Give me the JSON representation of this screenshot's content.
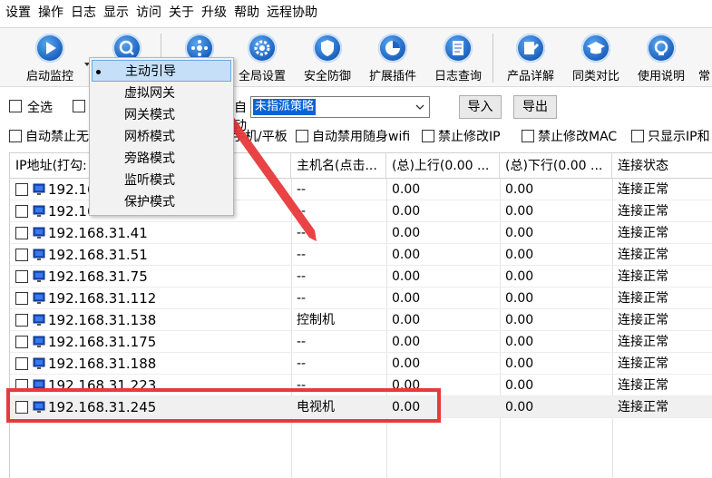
{
  "menu": [
    "设置",
    "操作",
    "日志",
    "显示",
    "访问",
    "关于",
    "升级",
    "帮助",
    "远程协助"
  ],
  "toolbar": {
    "buttons": [
      {
        "label": "启动监控",
        "icon": "play-icon"
      },
      {
        "label": "",
        "icon": "search-icon"
      },
      {
        "label": "",
        "icon": "move-icon"
      },
      {
        "label": "全局设置",
        "icon": "gear-icon"
      },
      {
        "label": "安全防御",
        "icon": "shield-icon"
      },
      {
        "label": "扩展插件",
        "icon": "pie-chart-icon"
      },
      {
        "label": "日志查询",
        "icon": "document-icon"
      },
      {
        "label": "产品详解",
        "icon": "edit-icon"
      },
      {
        "label": "同类对比",
        "icon": "graduation-icon"
      },
      {
        "label": "使用说明",
        "icon": "help-icon"
      },
      {
        "label": "常",
        "icon": "more-icon"
      }
    ]
  },
  "filter": {
    "select_all": "全选",
    "partial_label": "自动",
    "policy_value": "未指派策略",
    "import": "导入",
    "export": "导出"
  },
  "options": {
    "auto_block_prefix": "自动禁止无",
    "mobile_tablet": "手机/平板",
    "auto_block_wifi": "自动禁用随身wifi",
    "block_ip_change": "禁止修改IP",
    "block_mac_change": "禁止修改MAC",
    "show_ip_only": "只显示IP和"
  },
  "columns": [
    "IP地址(打勾:",
    "主机名(点击...",
    "(总)上行(0.00 ...",
    "(总)下行(0.00 ...",
    "连接状态"
  ],
  "rows": [
    {
      "ip": "192.16",
      "host": "--",
      "up": "0.00",
      "down": "0.00",
      "status": "连接正常"
    },
    {
      "ip": "192.16",
      "host": "--",
      "up": "0.00",
      "down": "0.00",
      "status": "连接正常"
    },
    {
      "ip": "192.168.31.41",
      "host": "--",
      "up": "0.00",
      "down": "0.00",
      "status": "连接正常"
    },
    {
      "ip": "192.168.31.51",
      "host": "--",
      "up": "0.00",
      "down": "0.00",
      "status": "连接正常"
    },
    {
      "ip": "192.168.31.75",
      "host": "--",
      "up": "0.00",
      "down": "0.00",
      "status": "连接正常"
    },
    {
      "ip": "192.168.31.112",
      "host": "--",
      "up": "0.00",
      "down": "0.00",
      "status": "连接正常"
    },
    {
      "ip": "192.168.31.138",
      "host": "控制机",
      "up": "0.00",
      "down": "0.00",
      "status": "连接正常"
    },
    {
      "ip": "192.168.31.175",
      "host": "--",
      "up": "0.00",
      "down": "0.00",
      "status": "连接正常"
    },
    {
      "ip": "192.168.31.188",
      "host": "--",
      "up": "0.00",
      "down": "0.00",
      "status": "连接正常"
    },
    {
      "ip": "192.168.31.223",
      "host": "--",
      "up": "0.00",
      "down": "0.00",
      "status": "连接正常"
    },
    {
      "ip": "192.168.31.245",
      "host": "电视机",
      "up": "0.00",
      "down": "0.00",
      "status": "连接正常"
    }
  ],
  "dropdown": {
    "items": [
      "主动引导",
      "虚拟网关",
      "网关模式",
      "网桥模式",
      "旁路模式",
      "监听模式",
      "保护模式"
    ],
    "selected_index": 0
  },
  "colors": {
    "accent": "#1f66c2",
    "highlight_box": "#e8393b",
    "selection": "#0a64d6",
    "dropdown_hover": "#c5dff8"
  }
}
